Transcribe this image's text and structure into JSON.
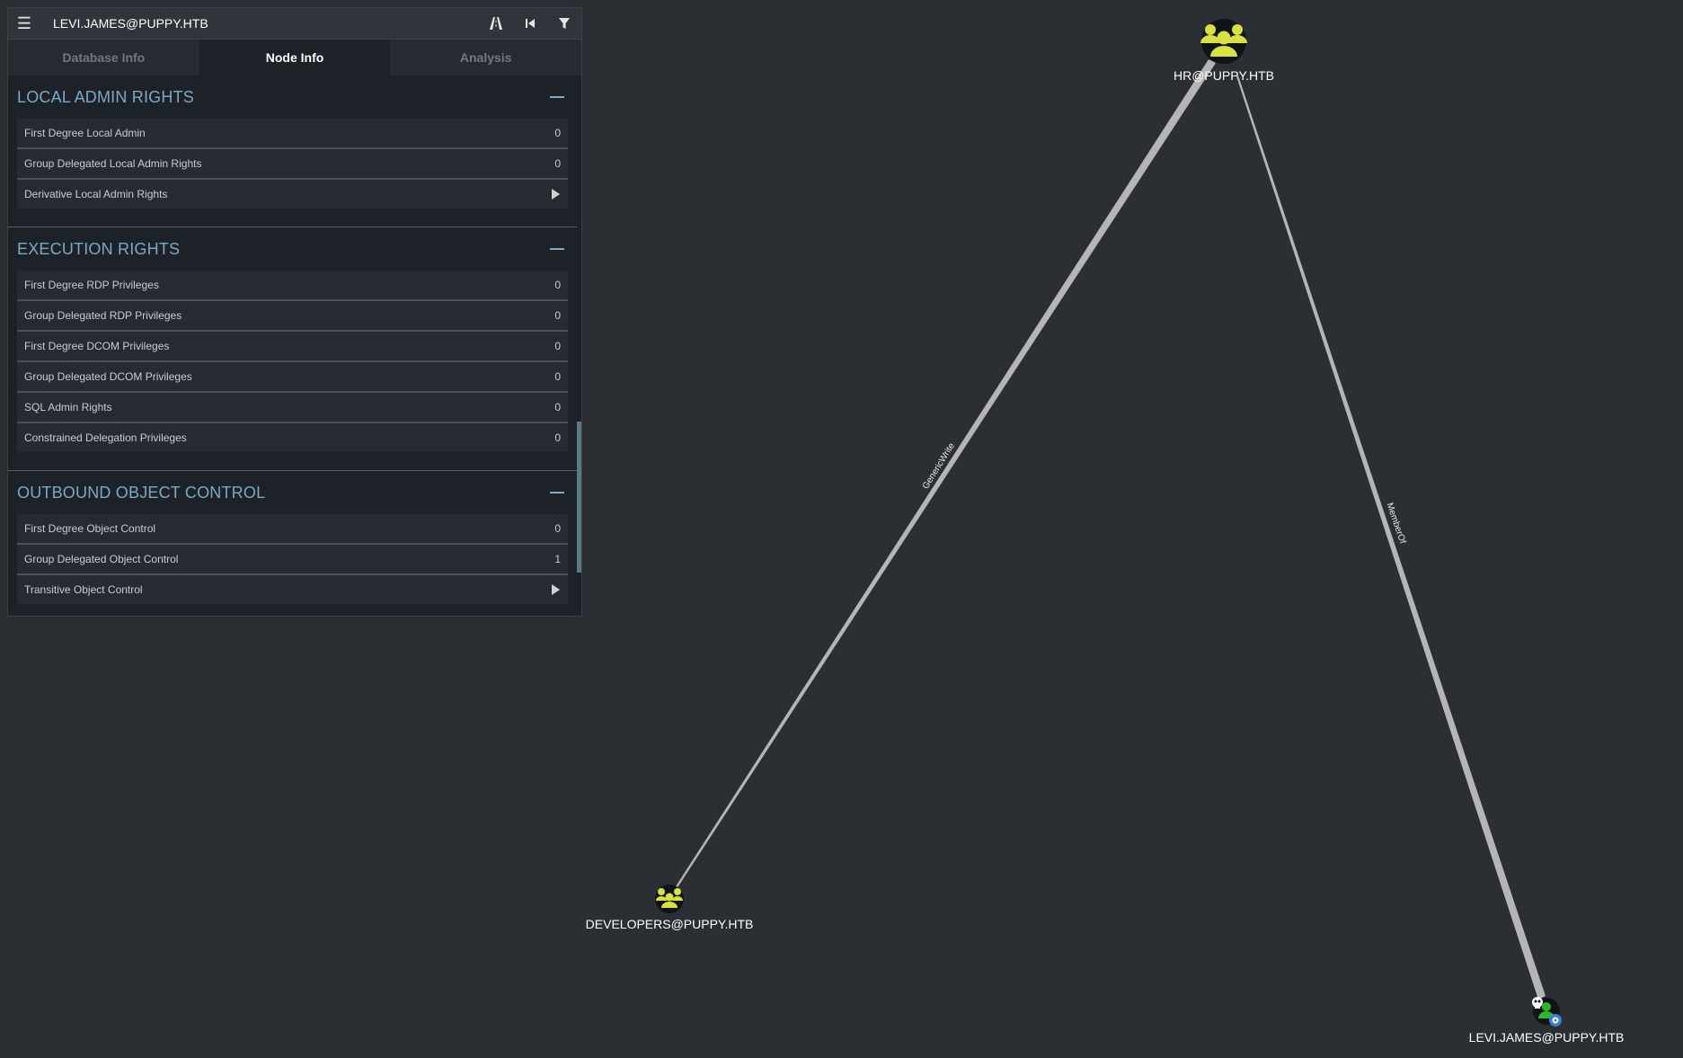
{
  "search": {
    "value": "LEVI.JAMES@PUPPY.HTB"
  },
  "toolbar": {
    "menu_icon": "hamburger-icon",
    "pathfinding_icon": "road-icon",
    "back_icon": "skip-back-icon",
    "filter_icon": "filter-icon"
  },
  "tabs": [
    {
      "label": "Database Info"
    },
    {
      "label": "Node Info"
    },
    {
      "label": "Analysis"
    }
  ],
  "sections": {
    "local_admin": {
      "title": "LOCAL ADMIN RIGHTS",
      "rows": [
        {
          "label": "First Degree Local Admin",
          "value": "0"
        },
        {
          "label": "Group Delegated Local Admin Rights",
          "value": "0"
        },
        {
          "label": "Derivative Local Admin Rights",
          "value": ""
        }
      ]
    },
    "execution": {
      "title": "EXECUTION RIGHTS",
      "rows": [
        {
          "label": "First Degree RDP Privileges",
          "value": "0"
        },
        {
          "label": "Group Delegated RDP Privileges",
          "value": "0"
        },
        {
          "label": "First Degree DCOM Privileges",
          "value": "0"
        },
        {
          "label": "Group Delegated DCOM Privileges",
          "value": "0"
        },
        {
          "label": "SQL Admin Rights",
          "value": "0"
        },
        {
          "label": "Constrained Delegation Privileges",
          "value": "0"
        }
      ]
    },
    "outbound": {
      "title": "OUTBOUND OBJECT CONTROL",
      "rows": [
        {
          "label": "First Degree Object Control",
          "value": "0"
        },
        {
          "label": "Group Delegated Object Control",
          "value": "1"
        },
        {
          "label": "Transitive Object Control",
          "value": ""
        }
      ]
    }
  },
  "graph": {
    "nodes": {
      "hr": {
        "label": "HR@PUPPY.HTB",
        "type": "group",
        "color": "#d8e042"
      },
      "developers": {
        "label": "DEVELOPERS@PUPPY.HTB",
        "type": "group",
        "color": "#d8e042"
      },
      "levi": {
        "label": "LEVI.JAMES@PUPPY.HTB",
        "type": "user",
        "color": "#2eb82e"
      }
    },
    "edges": {
      "generic_write": {
        "label": "GenericWrite",
        "from": "HR@PUPPY.HTB",
        "to": "DEVELOPERS@PUPPY.HTB"
      },
      "member_of": {
        "label": "MemberOf",
        "from": "LEVI.JAMES@PUPPY.HTB",
        "to": "HR@PUPPY.HTB"
      }
    }
  }
}
